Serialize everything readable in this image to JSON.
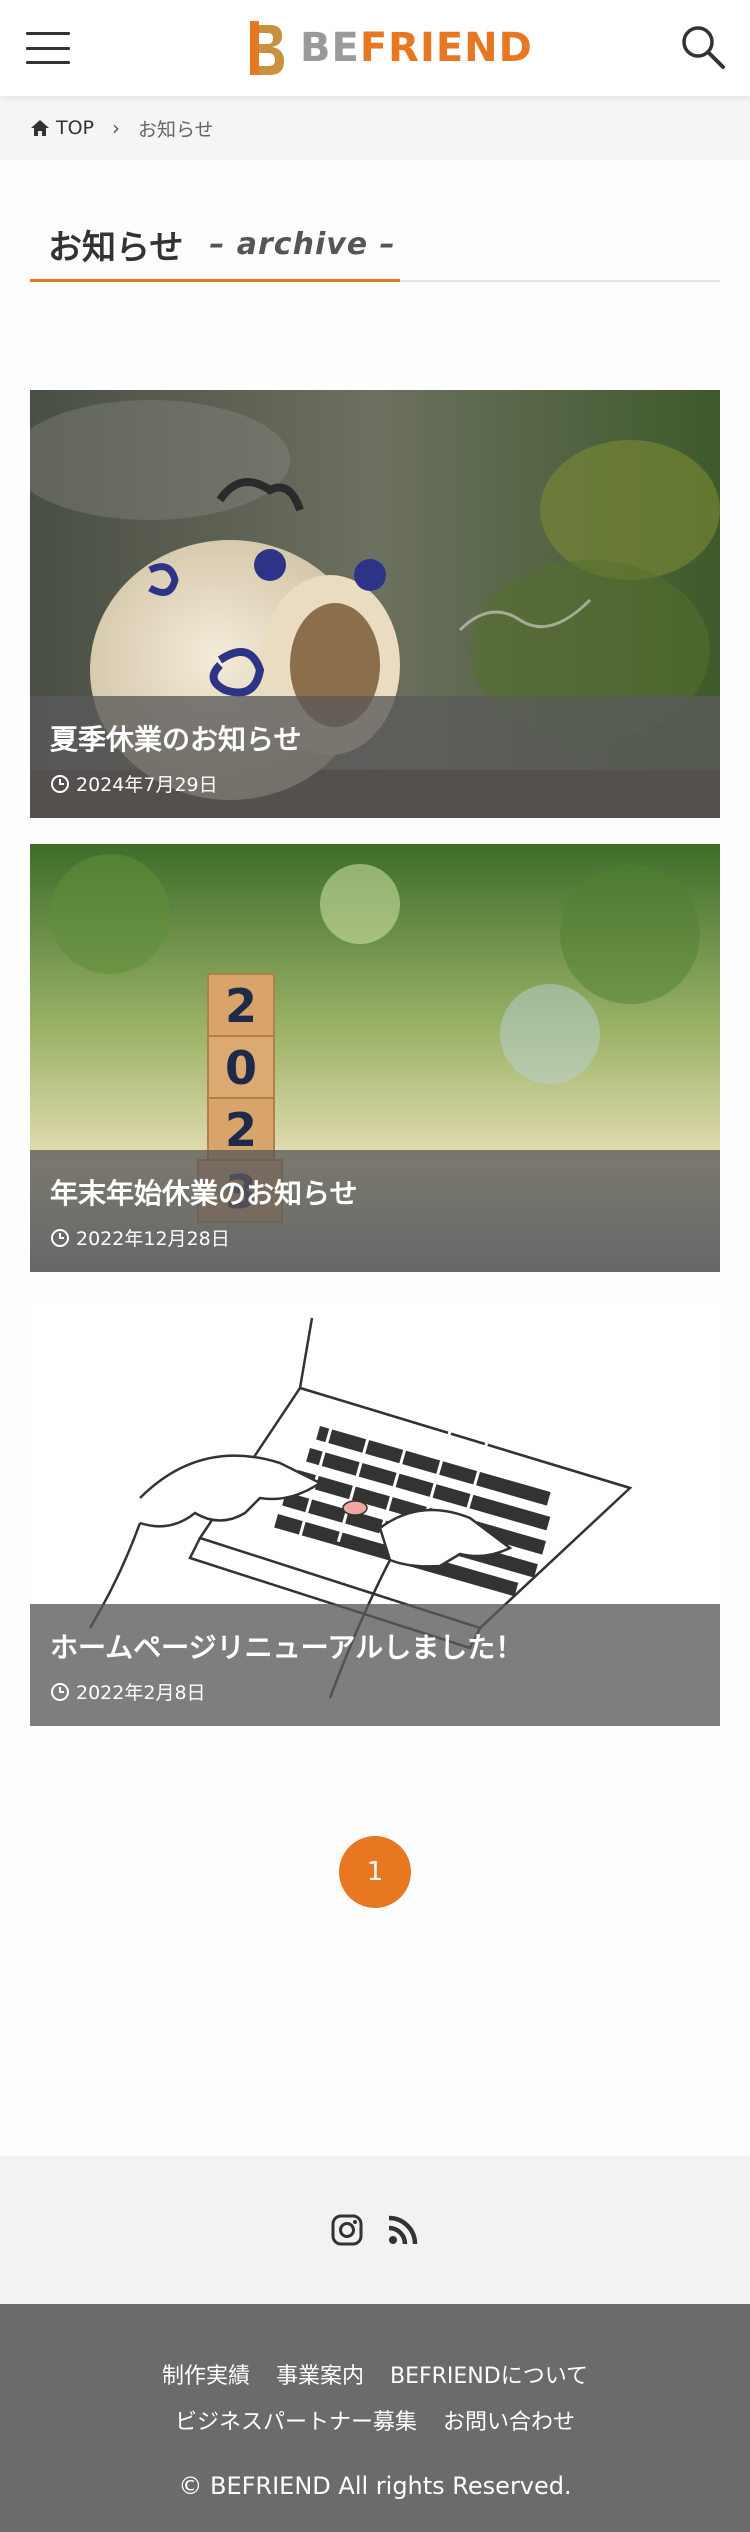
{
  "header": {
    "logo_be": "BE",
    "logo_friend": "FRIEND",
    "menu_icon": "hamburger-icon",
    "search_icon": "search-icon"
  },
  "breadcrumb": {
    "home_label": "TOP",
    "current": "お知らせ"
  },
  "page": {
    "title": "お知らせ",
    "subtitle": "– archive –"
  },
  "posts": [
    {
      "title": "夏季休業のお知らせ",
      "date": "2024年7月29日"
    },
    {
      "title": "年末年始休業のお知らせ",
      "date": "2022年12月28日"
    },
    {
      "title": "ホームページリニューアルしました！",
      "date": "2022年2月8日"
    }
  ],
  "pagination": {
    "current": "1"
  },
  "footer": {
    "nav_row1": [
      "制作実績",
      "事業案内",
      "BEFRIENDについて"
    ],
    "nav_row2": [
      "ビジネスパートナー募集",
      "お問い合わせ"
    ],
    "copyright": "© BEFRIEND All rights Reserved.",
    "social_icons": [
      "instagram-icon",
      "rss-icon"
    ]
  },
  "colors": {
    "accent": "#e87722",
    "footer_bg": "#6b6b6b",
    "breadcrumb_bg": "#f5f5f5"
  }
}
